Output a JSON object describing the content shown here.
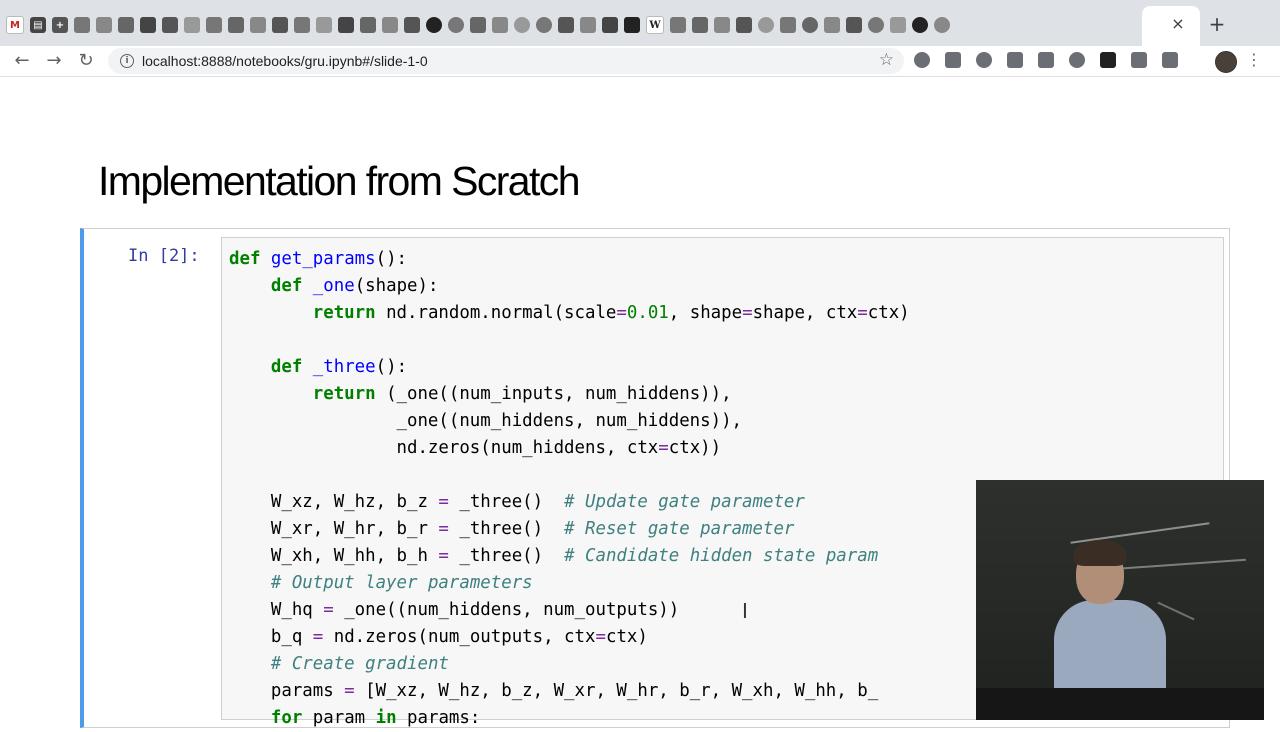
{
  "browser": {
    "tab_close": "×",
    "new_tab": "+",
    "back": "←",
    "forward": "→",
    "reload": "↻",
    "url": "localhost:8888/notebooks/gru.ipynb#/slide-1-0",
    "menu": "⋮"
  },
  "notebook": {
    "title": "Implementation from Scratch",
    "prompt": "In [2]:"
  },
  "colors": {
    "cell_border_active": "#4c9be8",
    "keyword": "#008000",
    "comment": "#408080",
    "prompt": "#303f9f"
  },
  "code_lines": [
    [
      "def",
      " ",
      "get_params",
      "():"
    ],
    [
      "    ",
      "def",
      " ",
      "_one",
      "(shape):"
    ],
    [
      "        ",
      "return",
      " nd.random.normal(scale",
      "=",
      "0.01",
      ", shape",
      "=",
      "shape, ctx",
      "=",
      "ctx)"
    ],
    [
      ""
    ],
    [
      "    ",
      "def",
      " ",
      "_three",
      "():"
    ],
    [
      "        ",
      "return",
      " (_one((num_inputs, num_hiddens)),"
    ],
    [
      "                _one((num_hiddens, num_hiddens)),"
    ],
    [
      "                nd.zeros(num_hiddens, ctx",
      "=",
      "ctx))"
    ],
    [
      ""
    ],
    [
      "    W_xz, W_hz, b_z ",
      "=",
      " _three()  ",
      "# Update gate parameter"
    ],
    [
      "    W_xr, W_hr, b_r ",
      "=",
      " _three()  ",
      "# Reset gate parameter"
    ],
    [
      "    W_xh, W_hh, b_h ",
      "=",
      " _three()  ",
      "# Candidate hidden state param"
    ],
    [
      "    ",
      "# Output layer parameters"
    ],
    [
      "    W_hq ",
      "=",
      " _one((num_hiddens, num_outputs))"
    ],
    [
      "    b_q ",
      "=",
      " nd.zeros(num_outputs, ctx",
      "=",
      "ctx)"
    ],
    [
      "    ",
      "# Create gradient"
    ],
    [
      "    params ",
      "=",
      " [W_xz, W_hz, b_z, W_xr, W_hr, b_r, W_xh, W_hh, b_"
    ],
    [
      "    ",
      "for",
      " param ",
      "in",
      " params:"
    ]
  ],
  "icons": [
    "gmail-icon",
    "docs-icon",
    "sheets-icon",
    "github-icon",
    "wikipedia-icon",
    "star-icon",
    "extension-icon",
    "avatar"
  ]
}
